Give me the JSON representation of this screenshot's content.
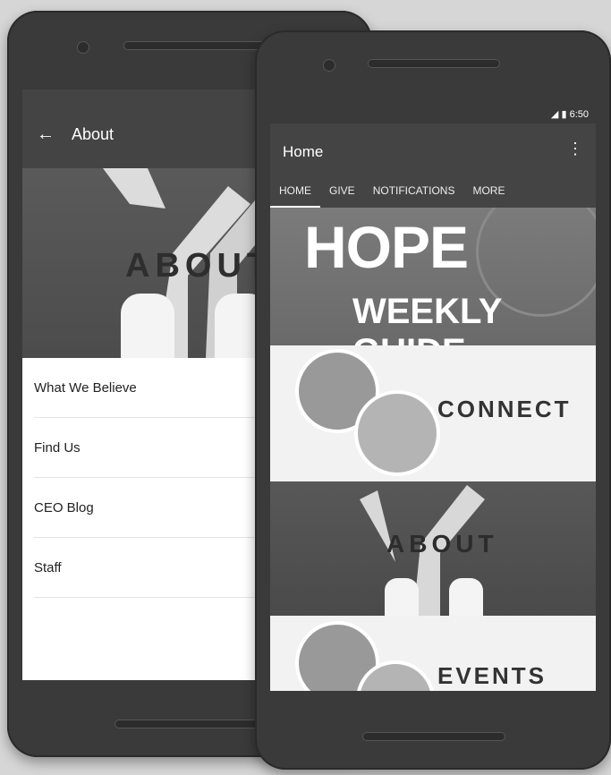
{
  "back_phone": {
    "appbar_title": "About",
    "hero_text": "ABOUT",
    "menu_items": [
      {
        "label": "What We Believe"
      },
      {
        "label": "Find Us"
      },
      {
        "label": "CEO Blog"
      },
      {
        "label": "Staff"
      }
    ]
  },
  "front_phone": {
    "status_time": "6:50",
    "toolbar_title": "Home",
    "overflow_icon": "⋮",
    "tabs": [
      "HOME",
      "GIVE",
      "NOTIFICATIONS",
      "MORE"
    ],
    "banners": {
      "hope_line1": "HOPE",
      "hope_line2": "WEEKLY GUIDE",
      "connect": "CONNECT",
      "about": "ABOUT",
      "events": "EVENTS"
    }
  }
}
